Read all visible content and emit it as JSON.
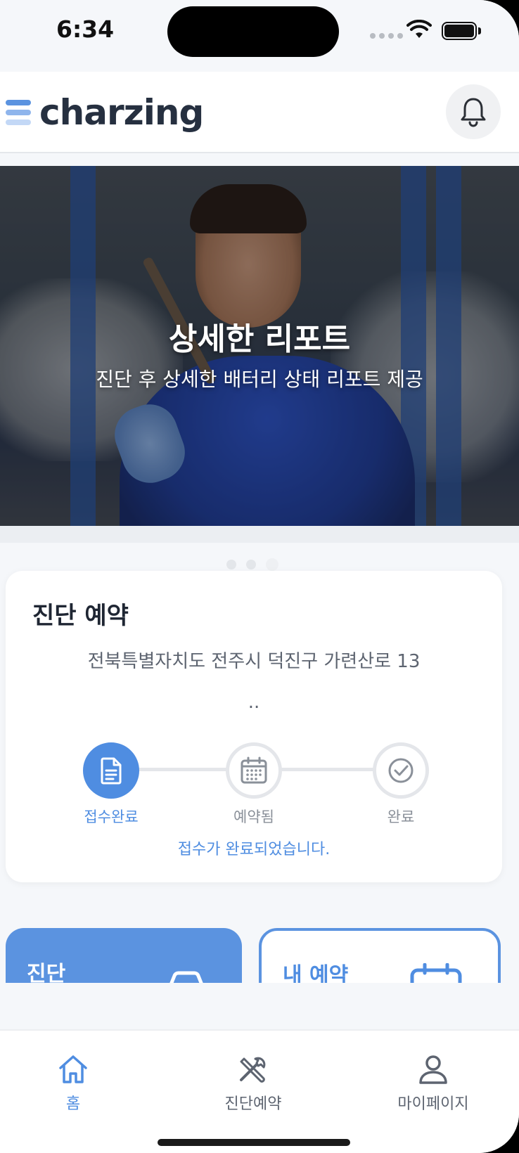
{
  "status_bar": {
    "time": "6:34"
  },
  "header": {
    "logo_text": "charzing",
    "logo_bar_colors": [
      "#5b93e0",
      "#8fb5ec",
      "#c3d8f6"
    ]
  },
  "banner": {
    "title": "상세한 리포트",
    "subtitle": "진단 후 상세한 배터리 상태 리포트 제공",
    "slides_count": 3,
    "active_slide": 3
  },
  "reservation_card": {
    "title": "진단 예약",
    "address": "전북특별자치도 전주시 덕진구 가련산로 13",
    "address_detail": "..",
    "steps": [
      {
        "label": "접수완료",
        "icon": "document-icon",
        "active": true
      },
      {
        "label": "예약됨",
        "icon": "calendar-icon",
        "active": false
      },
      {
        "label": "완료",
        "icon": "check-circle-icon",
        "active": false
      }
    ],
    "status_message": "접수가 완료되었습니다."
  },
  "tiles": {
    "diagnosis": {
      "label": "진단",
      "icon": "car-icon"
    },
    "my_reservation": {
      "label": "내 예약",
      "icon": "calendar-icon"
    }
  },
  "bottom_nav": {
    "items": [
      {
        "label": "홈",
        "icon": "home-icon",
        "active": true
      },
      {
        "label": "진단예약",
        "icon": "tools-icon",
        "active": false
      },
      {
        "label": "마이페이지",
        "icon": "user-icon",
        "active": false
      }
    ]
  },
  "colors": {
    "accent": "#4f8de1",
    "background": "#f5f7fa",
    "text_dark": "#1f2633"
  }
}
